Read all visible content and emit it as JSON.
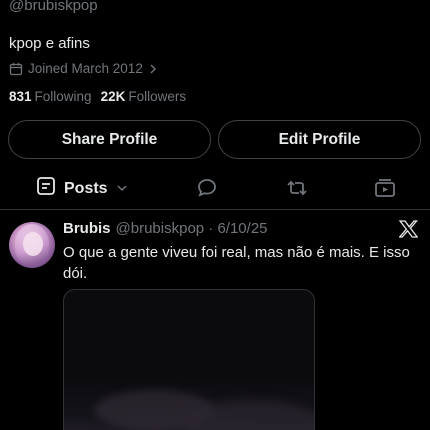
{
  "profile": {
    "handle": "@brubiskpop",
    "bio": "kpop e afins",
    "joined": "Joined March 2012",
    "following_count": "831",
    "following_label": "Following",
    "followers_count": "22K",
    "followers_label": "Followers"
  },
  "actions": {
    "share_label": "Share Profile",
    "edit_label": "Edit Profile"
  },
  "tabs": {
    "posts_label": "Posts",
    "icons": [
      "chat-bubble-icon",
      "repost-icon",
      "media-icon"
    ]
  },
  "post": {
    "author": "Brubis",
    "meta": "@brubiskpop · 6/10/25",
    "text": "O que a gente viveu foi real, mas não é mais. E isso dói."
  },
  "colors": {
    "background": "#000000",
    "text": "#e7e9ea",
    "muted": "#71767b",
    "border": "#2f3336"
  }
}
